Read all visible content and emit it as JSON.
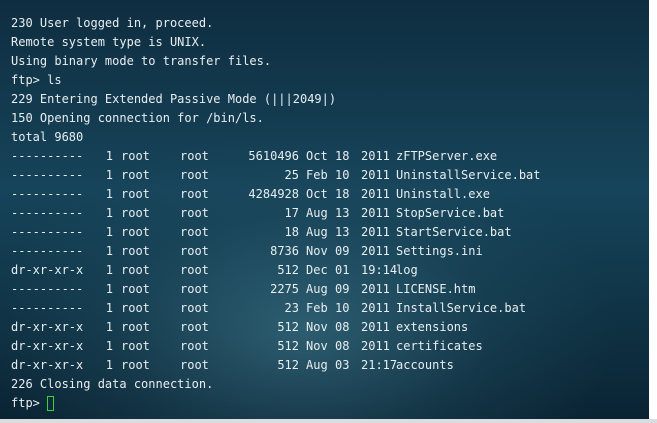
{
  "terminal": {
    "preamble": [
      "230 User logged in, proceed.",
      "Remote system type is UNIX.",
      "Using binary mode to transfer files.",
      "ftp> ls",
      "229 Entering Extended Passive Mode (|||2049|)",
      "150 Opening connection for /bin/ls.",
      "total 9680"
    ],
    "listing": [
      {
        "perm": "----------",
        "links": "1",
        "owner": "root",
        "group": "root",
        "size": "5610496",
        "month": "Oct",
        "day": "18",
        "time_or_year": "2011",
        "name": "zFTPServer.exe"
      },
      {
        "perm": "----------",
        "links": "1",
        "owner": "root",
        "group": "root",
        "size": "25",
        "month": "Feb",
        "day": "10",
        "time_or_year": "2011",
        "name": "UninstallService.bat"
      },
      {
        "perm": "----------",
        "links": "1",
        "owner": "root",
        "group": "root",
        "size": "4284928",
        "month": "Oct",
        "day": "18",
        "time_or_year": "2011",
        "name": "Uninstall.exe"
      },
      {
        "perm": "----------",
        "links": "1",
        "owner": "root",
        "group": "root",
        "size": "17",
        "month": "Aug",
        "day": "13",
        "time_or_year": "2011",
        "name": "StopService.bat"
      },
      {
        "perm": "----------",
        "links": "1",
        "owner": "root",
        "group": "root",
        "size": "18",
        "month": "Aug",
        "day": "13",
        "time_or_year": "2011",
        "name": "StartService.bat"
      },
      {
        "perm": "----------",
        "links": "1",
        "owner": "root",
        "group": "root",
        "size": "8736",
        "month": "Nov",
        "day": "09",
        "time_or_year": "2011",
        "name": "Settings.ini"
      },
      {
        "perm": "dr-xr-xr-x",
        "links": "1",
        "owner": "root",
        "group": "root",
        "size": "512",
        "month": "Dec",
        "day": "01",
        "time_or_year": "19:14",
        "name": "log"
      },
      {
        "perm": "----------",
        "links": "1",
        "owner": "root",
        "group": "root",
        "size": "2275",
        "month": "Aug",
        "day": "09",
        "time_or_year": "2011",
        "name": "LICENSE.htm"
      },
      {
        "perm": "----------",
        "links": "1",
        "owner": "root",
        "group": "root",
        "size": "23",
        "month": "Feb",
        "day": "10",
        "time_or_year": "2011",
        "name": "InstallService.bat"
      },
      {
        "perm": "dr-xr-xr-x",
        "links": "1",
        "owner": "root",
        "group": "root",
        "size": "512",
        "month": "Nov",
        "day": "08",
        "time_or_year": "2011",
        "name": "extensions"
      },
      {
        "perm": "dr-xr-xr-x",
        "links": "1",
        "owner": "root",
        "group": "root",
        "size": "512",
        "month": "Nov",
        "day": "08",
        "time_or_year": "2011",
        "name": "certificates"
      },
      {
        "perm": "dr-xr-xr-x",
        "links": "1",
        "owner": "root",
        "group": "root",
        "size": "512",
        "month": "Aug",
        "day": "03",
        "time_or_year": "21:17",
        "name": "accounts"
      }
    ],
    "closing": "226 Closing data connection.",
    "prompt": "ftp>",
    "cursor_color": "#39d23a",
    "text_color": "#e8eef0"
  }
}
